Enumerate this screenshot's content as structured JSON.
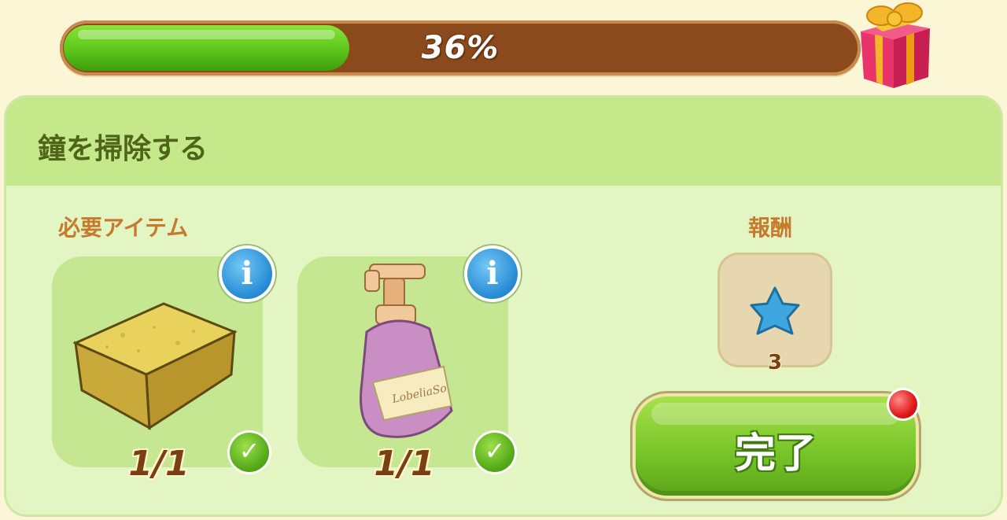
{
  "progress": {
    "percent": 36,
    "label": "36%"
  },
  "gift": {
    "icon": "gift-box-icon"
  },
  "quest": {
    "title": "鐘を掃除する"
  },
  "required": {
    "label": "必要アイテム",
    "items": [
      {
        "icon": "sponge-icon",
        "count": "1/1",
        "done": true
      },
      {
        "icon": "soap-bottle-icon",
        "count": "1/1",
        "done": true
      }
    ]
  },
  "reward": {
    "label": "報酬",
    "icon": "blue-star-icon",
    "count": "3"
  },
  "complete_button": {
    "label": "完了"
  },
  "colors": {
    "progress_fill": "#5cc51a",
    "progress_track": "#8a4a1c",
    "title": "#4f6418",
    "label": "#c57a2d"
  }
}
